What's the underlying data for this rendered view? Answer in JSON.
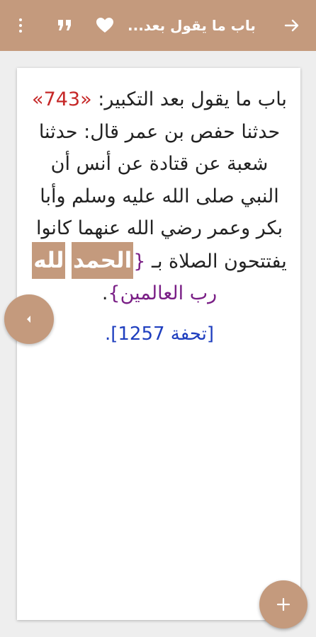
{
  "header": {
    "title": "باب ما يقول بعد...",
    "menu_icon": "more-vert-icon",
    "quote_icon": "quote-icon",
    "heart_icon": "heart-icon",
    "back_icon": "arrow-forward-icon"
  },
  "hadith": {
    "chapter": "باب ما يقول بعد التكبير:",
    "number": "«743»",
    "text_1": " حدثنا حفص بن عمر قال: حدثنا شعبة عن قتادة عن أنس أن النبي صلى الله عليه وسلم وأبا بكر وعمر رضي الله عنهما كانوا يفتتحون الصلاة بـ ",
    "quran_open": "{",
    "highlight_1": "الحمد",
    "space": " ",
    "highlight_2": "لله",
    "quran_rest": " رب العالمين}",
    "period": ".",
    "reference": "[تحفة 1257]",
    "reference_period": "."
  },
  "side_tab_icon": "chevron-left-icon",
  "fab_icon": "plus-icon",
  "colors": {
    "accent": "#c49a7d",
    "number": "#c62828",
    "quran": "#7a1f86",
    "reference": "#1f3fbf"
  }
}
